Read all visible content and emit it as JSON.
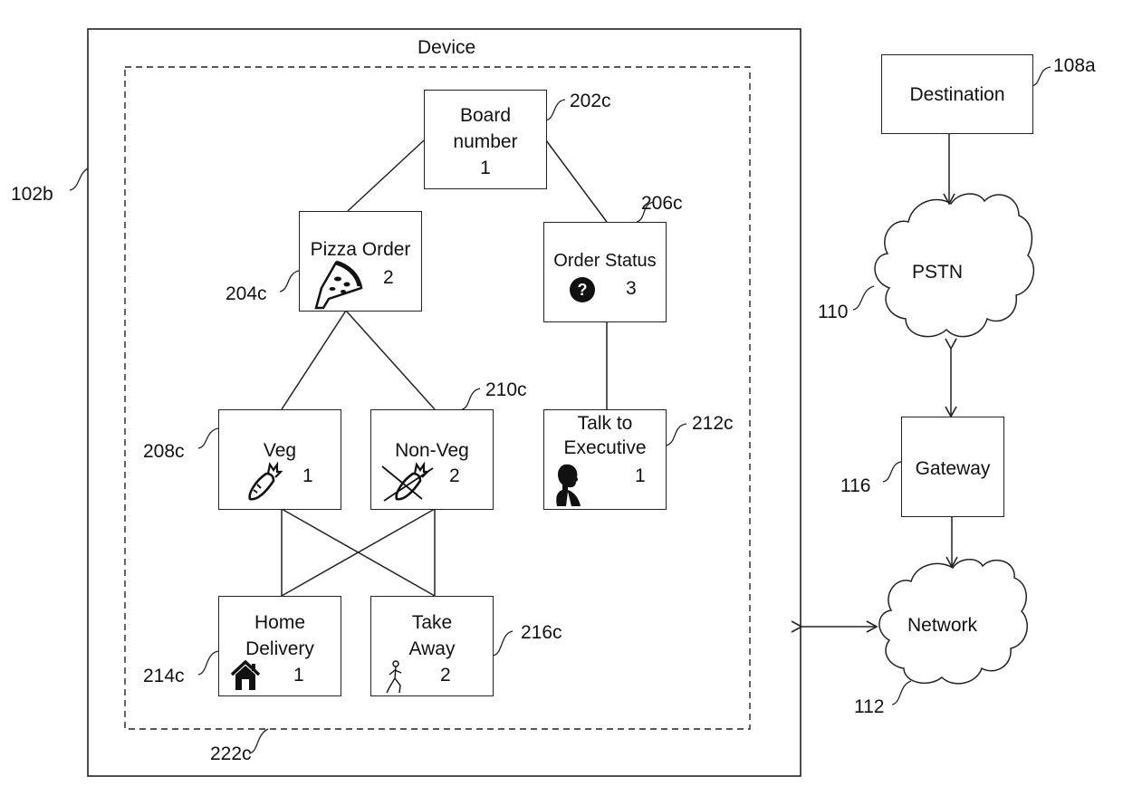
{
  "device": {
    "title": "Device",
    "ref": "102b",
    "group_ref": "222c"
  },
  "nodes": {
    "board": {
      "label_line1": "Board",
      "label_line2": "number",
      "number": "1",
      "ref": "202c"
    },
    "pizza": {
      "label": "Pizza Order",
      "number": "2",
      "ref": "204c",
      "icon": "pizza-slice-icon"
    },
    "status": {
      "label": "Order Status",
      "number": "3",
      "ref": "206c",
      "icon": "question-circle-icon",
      "icon_glyph": "?"
    },
    "veg": {
      "label": "Veg",
      "number": "1",
      "ref": "208c",
      "icon": "carrot-icon"
    },
    "nonveg": {
      "label": "Non-Veg",
      "number": "2",
      "ref": "210c",
      "icon": "crossed-carrot-icon"
    },
    "executive": {
      "label_line1": "Talk to",
      "label_line2": "Executive",
      "number": "1",
      "ref": "212c",
      "icon": "person-silhouette-icon"
    },
    "home": {
      "label_line1": "Home",
      "label_line2": "Delivery",
      "number": "1",
      "ref": "214c",
      "icon": "house-icon"
    },
    "takeaway": {
      "label_line1": "Take",
      "label_line2": "Away",
      "number": "2",
      "ref": "216c",
      "icon": "walking-person-icon"
    }
  },
  "external": {
    "destination": {
      "label": "Destination",
      "ref": "108a"
    },
    "pstn": {
      "label": "PSTN",
      "ref": "110"
    },
    "gateway": {
      "label": "Gateway",
      "ref": "116"
    },
    "network": {
      "label": "Network",
      "ref": "112"
    }
  },
  "colors": {
    "line": "#222222",
    "background": "#ffffff",
    "text": "#111111"
  }
}
